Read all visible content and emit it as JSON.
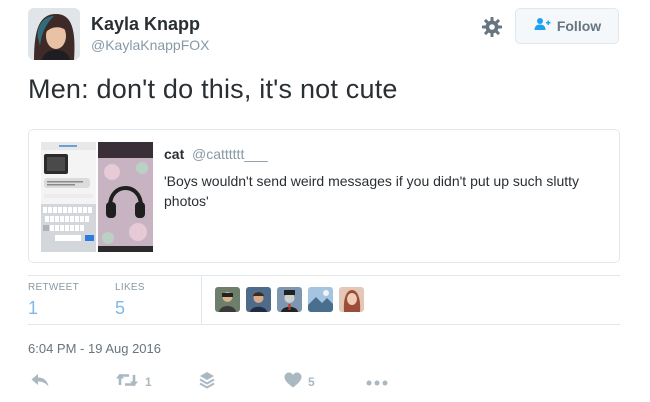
{
  "author": {
    "display_name": "Kayla Knapp",
    "handle": "@KaylaKnappFOX"
  },
  "follow_button": {
    "label": "Follow"
  },
  "tweet": {
    "text": "Men: don't do this, it's not cute"
  },
  "quoted_tweet": {
    "name": "cat",
    "handle": "@catttttt___",
    "text": "'Boys wouldn't send weird messages if you didn't put up such slutty photos'"
  },
  "stats": {
    "retweets_label": "RETWEET",
    "retweets_count": "1",
    "likes_label": "LIKES",
    "likes_count": "5"
  },
  "timestamp": "6:04 PM - 19 Aug 2016",
  "actions": {
    "retweet_count": "1",
    "like_count": "5"
  },
  "colors": {
    "stat_value": "#7fb9ea",
    "muted": "#8899a6",
    "border": "#e1e8ed",
    "action_icon": "#aab8c2"
  },
  "icons": [
    "gear-icon",
    "follow-person-icon",
    "reply-icon",
    "retweet-icon",
    "stack-icon",
    "heart-icon",
    "more-icon"
  ]
}
